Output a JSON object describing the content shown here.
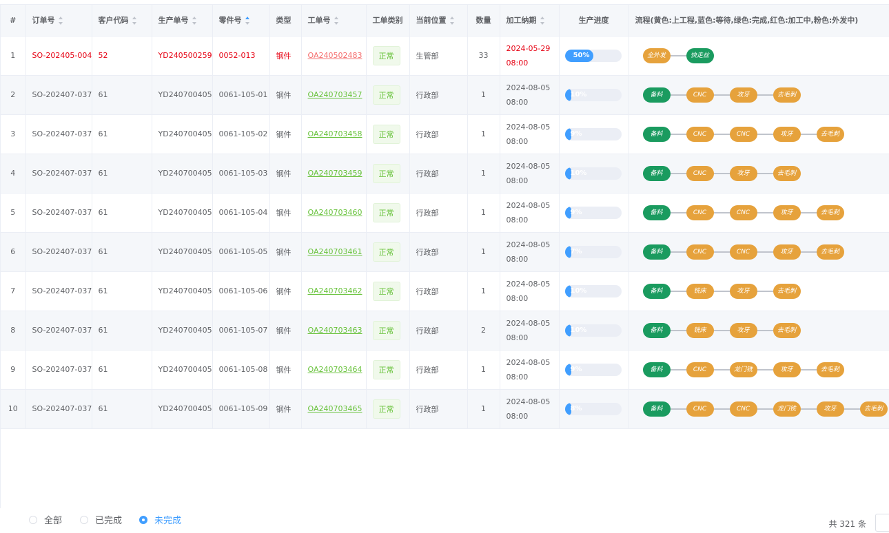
{
  "columns": {
    "index": "#",
    "order": "订单号",
    "customer": "客户代码",
    "prod": "生产单号",
    "part": "零件号",
    "type": "类型",
    "wo": "工单号",
    "wotype": "工单类别",
    "location": "当前位置",
    "qty": "数量",
    "due": "加工纳期",
    "progress": "生产进度",
    "flow": "流程(黄色:上工程,蓝色:等待,绿色:完成,红色:加工中,粉色:外发中)"
  },
  "rows": [
    {
      "idx": "1",
      "order": "SO-202405-004",
      "customer": "52",
      "prod": "YD240500259",
      "part": "0052-013",
      "type": "钢件",
      "wo": "OA240502483",
      "wotype": "正常",
      "location": "生管部",
      "qty": "33",
      "due": "2024-05-29 08:00",
      "progress": "50%",
      "progress_value": 50,
      "highlight": true,
      "flow": [
        {
          "label": "全外发",
          "color": "yellow"
        },
        {
          "label": "快走丝",
          "color": "green"
        }
      ]
    },
    {
      "idx": "2",
      "order": "SO-202407-037",
      "customer": "61",
      "prod": "YD240700405",
      "part": "0061-105-01",
      "type": "钢件",
      "wo": "OA240703457",
      "wotype": "正常",
      "location": "行政部",
      "qty": "1",
      "due": "2024-08-05 08:00",
      "progress": "10%",
      "progress_value": 10,
      "flow": [
        {
          "label": "备料",
          "color": "green"
        },
        {
          "label": "CNC",
          "color": "yellow"
        },
        {
          "label": "攻牙",
          "color": "yellow"
        },
        {
          "label": "去毛刺",
          "color": "yellow"
        }
      ]
    },
    {
      "idx": "3",
      "order": "SO-202407-037",
      "customer": "61",
      "prod": "YD240700405",
      "part": "0061-105-02",
      "type": "钢件",
      "wo": "OA240703458",
      "wotype": "正常",
      "location": "行政部",
      "qty": "1",
      "due": "2024-08-05 08:00",
      "progress": "9%",
      "progress_value": 9,
      "flow": [
        {
          "label": "备料",
          "color": "green"
        },
        {
          "label": "CNC",
          "color": "yellow"
        },
        {
          "label": "CNC",
          "color": "yellow"
        },
        {
          "label": "攻牙",
          "color": "yellow"
        },
        {
          "label": "去毛刺",
          "color": "yellow"
        }
      ]
    },
    {
      "idx": "4",
      "order": "SO-202407-037",
      "customer": "61",
      "prod": "YD240700405",
      "part": "0061-105-03",
      "type": "钢件",
      "wo": "OA240703459",
      "wotype": "正常",
      "location": "行政部",
      "qty": "1",
      "due": "2024-08-05 08:00",
      "progress": "10%",
      "progress_value": 10,
      "flow": [
        {
          "label": "备料",
          "color": "green"
        },
        {
          "label": "CNC",
          "color": "yellow"
        },
        {
          "label": "攻牙",
          "color": "yellow"
        },
        {
          "label": "去毛刺",
          "color": "yellow"
        }
      ]
    },
    {
      "idx": "5",
      "order": "SO-202407-037",
      "customer": "61",
      "prod": "YD240700405",
      "part": "0061-105-04",
      "type": "钢件",
      "wo": "OA240703460",
      "wotype": "正常",
      "location": "行政部",
      "qty": "1",
      "due": "2024-08-05 08:00",
      "progress": "9%",
      "progress_value": 9,
      "flow": [
        {
          "label": "备料",
          "color": "green"
        },
        {
          "label": "CNC",
          "color": "yellow"
        },
        {
          "label": "CNC",
          "color": "yellow"
        },
        {
          "label": "攻牙",
          "color": "yellow"
        },
        {
          "label": "去毛刺",
          "color": "yellow"
        }
      ]
    },
    {
      "idx": "6",
      "order": "SO-202407-037",
      "customer": "61",
      "prod": "YD240700405",
      "part": "0061-105-05",
      "type": "钢件",
      "wo": "OA240703461",
      "wotype": "正常",
      "location": "行政部",
      "qty": "1",
      "due": "2024-08-05 08:00",
      "progress": "7%",
      "progress_value": 7,
      "flow": [
        {
          "label": "备料",
          "color": "green"
        },
        {
          "label": "CNC",
          "color": "yellow"
        },
        {
          "label": "CNC",
          "color": "yellow"
        },
        {
          "label": "攻牙",
          "color": "yellow"
        },
        {
          "label": "去毛刺",
          "color": "yellow"
        }
      ]
    },
    {
      "idx": "7",
      "order": "SO-202407-037",
      "customer": "61",
      "prod": "YD240700405",
      "part": "0061-105-06",
      "type": "钢件",
      "wo": "OA240703462",
      "wotype": "正常",
      "location": "行政部",
      "qty": "1",
      "due": "2024-08-05 08:00",
      "progress": "10%",
      "progress_value": 10,
      "flow": [
        {
          "label": "备料",
          "color": "green"
        },
        {
          "label": "铣床",
          "color": "yellow"
        },
        {
          "label": "攻牙",
          "color": "yellow"
        },
        {
          "label": "去毛刺",
          "color": "yellow"
        }
      ]
    },
    {
      "idx": "8",
      "order": "SO-202407-037",
      "customer": "61",
      "prod": "YD240700405",
      "part": "0061-105-07",
      "type": "钢件",
      "wo": "OA240703463",
      "wotype": "正常",
      "location": "行政部",
      "qty": "2",
      "due": "2024-08-05 08:00",
      "progress": "10%",
      "progress_value": 10,
      "flow": [
        {
          "label": "备料",
          "color": "green"
        },
        {
          "label": "铣床",
          "color": "yellow"
        },
        {
          "label": "攻牙",
          "color": "yellow"
        },
        {
          "label": "去毛刺",
          "color": "yellow"
        }
      ]
    },
    {
      "idx": "9",
      "order": "SO-202407-037",
      "customer": "61",
      "prod": "YD240700405",
      "part": "0061-105-08",
      "type": "钢件",
      "wo": "OA240703464",
      "wotype": "正常",
      "location": "行政部",
      "qty": "1",
      "due": "2024-08-05 08:00",
      "progress": "9%",
      "progress_value": 9,
      "flow": [
        {
          "label": "备料",
          "color": "green"
        },
        {
          "label": "CNC",
          "color": "yellow"
        },
        {
          "label": "龙门铣",
          "color": "yellow"
        },
        {
          "label": "攻牙",
          "color": "yellow"
        },
        {
          "label": "去毛刺",
          "color": "yellow"
        }
      ]
    },
    {
      "idx": "10",
      "order": "SO-202407-037",
      "customer": "61",
      "prod": "YD240700405",
      "part": "0061-105-09",
      "type": "钢件",
      "wo": "OA240703465",
      "wotype": "正常",
      "location": "行政部",
      "qty": "1",
      "due": "2024-08-05 08:00",
      "progress": "8%",
      "progress_value": 8,
      "flow": [
        {
          "label": "备料",
          "color": "green"
        },
        {
          "label": "CNC",
          "color": "yellow"
        },
        {
          "label": "CNC",
          "color": "yellow"
        },
        {
          "label": "龙门铣",
          "color": "yellow"
        },
        {
          "label": "攻牙",
          "color": "yellow"
        },
        {
          "label": "去毛刺",
          "color": "yellow"
        }
      ]
    }
  ],
  "filters": {
    "all": "全部",
    "done": "已完成",
    "undone": "未完成",
    "selected": "undone"
  },
  "pagination": {
    "total": "共 321 条"
  },
  "colors": {
    "accent": "#409eff",
    "highlight": "#e60012",
    "link": "#67c23a",
    "flow_pending": "#e6a23c",
    "flow_done": "#1a9b5f"
  }
}
